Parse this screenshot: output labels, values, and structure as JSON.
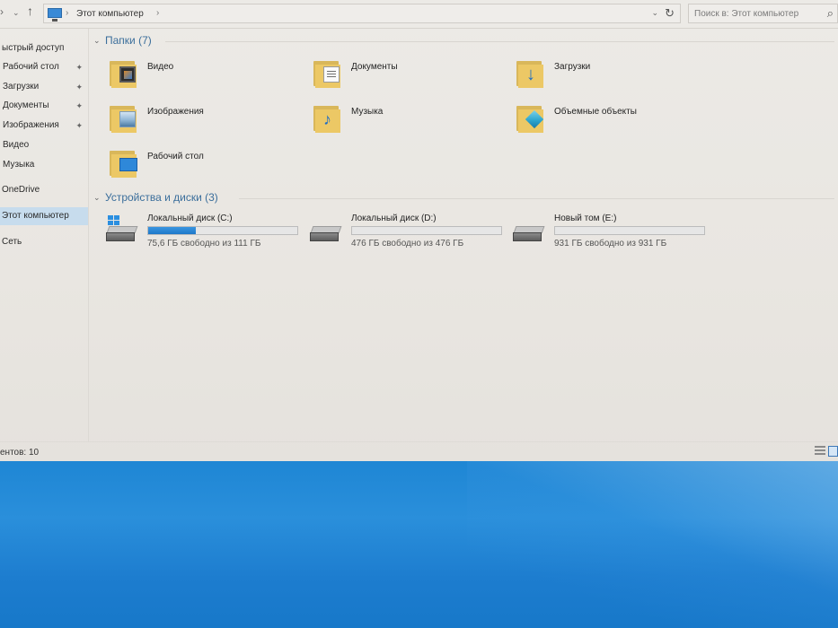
{
  "address": {
    "breadcrumb": "Этот компьютер",
    "search_placeholder": "Поиск в: Этот компьютер"
  },
  "sidebar": {
    "items": [
      {
        "label": "ыстрый доступ",
        "pinned": false
      },
      {
        "label": "Рабочий стол",
        "pinned": true
      },
      {
        "label": "Загрузки",
        "pinned": true
      },
      {
        "label": "Документы",
        "pinned": true
      },
      {
        "label": "Изображения",
        "pinned": true
      },
      {
        "label": "Видео",
        "pinned": false
      },
      {
        "label": "Музыка",
        "pinned": false
      },
      {
        "label": "OneDrive",
        "pinned": false
      },
      {
        "label": "Этот компьютер",
        "pinned": false,
        "selected": true
      },
      {
        "label": "Сеть",
        "pinned": false
      }
    ]
  },
  "folders": {
    "title": "Папки (7)",
    "items": [
      {
        "label": "Видео",
        "icon": "video-folder-icon"
      },
      {
        "label": "Документы",
        "icon": "documents-folder-icon"
      },
      {
        "label": "Загрузки",
        "icon": "downloads-folder-icon"
      },
      {
        "label": "Изображения",
        "icon": "pictures-folder-icon"
      },
      {
        "label": "Музыка",
        "icon": "music-folder-icon"
      },
      {
        "label": "Объемные объекты",
        "icon": "3d-objects-folder-icon"
      },
      {
        "label": "Рабочий стол",
        "icon": "desktop-folder-icon"
      }
    ]
  },
  "devices": {
    "title": "Устройства и диски (3)",
    "items": [
      {
        "name": "Локальный диск (C:)",
        "free": "75,6 ГБ свободно из 111 ГБ",
        "used_fraction": 0.32,
        "system": true
      },
      {
        "name": "Локальный диск (D:)",
        "free": "476 ГБ свободно из 476 ГБ",
        "used_fraction": 0.0,
        "system": false
      },
      {
        "name": "Новый том (E:)",
        "free": "931 ГБ свободно из 931 ГБ",
        "used_fraction": 0.0,
        "system": false
      }
    ]
  },
  "status": {
    "text": "ентов: 10"
  },
  "colors": {
    "accent": "#1e78c8",
    "group_title": "#3b6e9b",
    "selected_bg": "#c7dced",
    "desktop_blue": "#1f7fd0"
  }
}
